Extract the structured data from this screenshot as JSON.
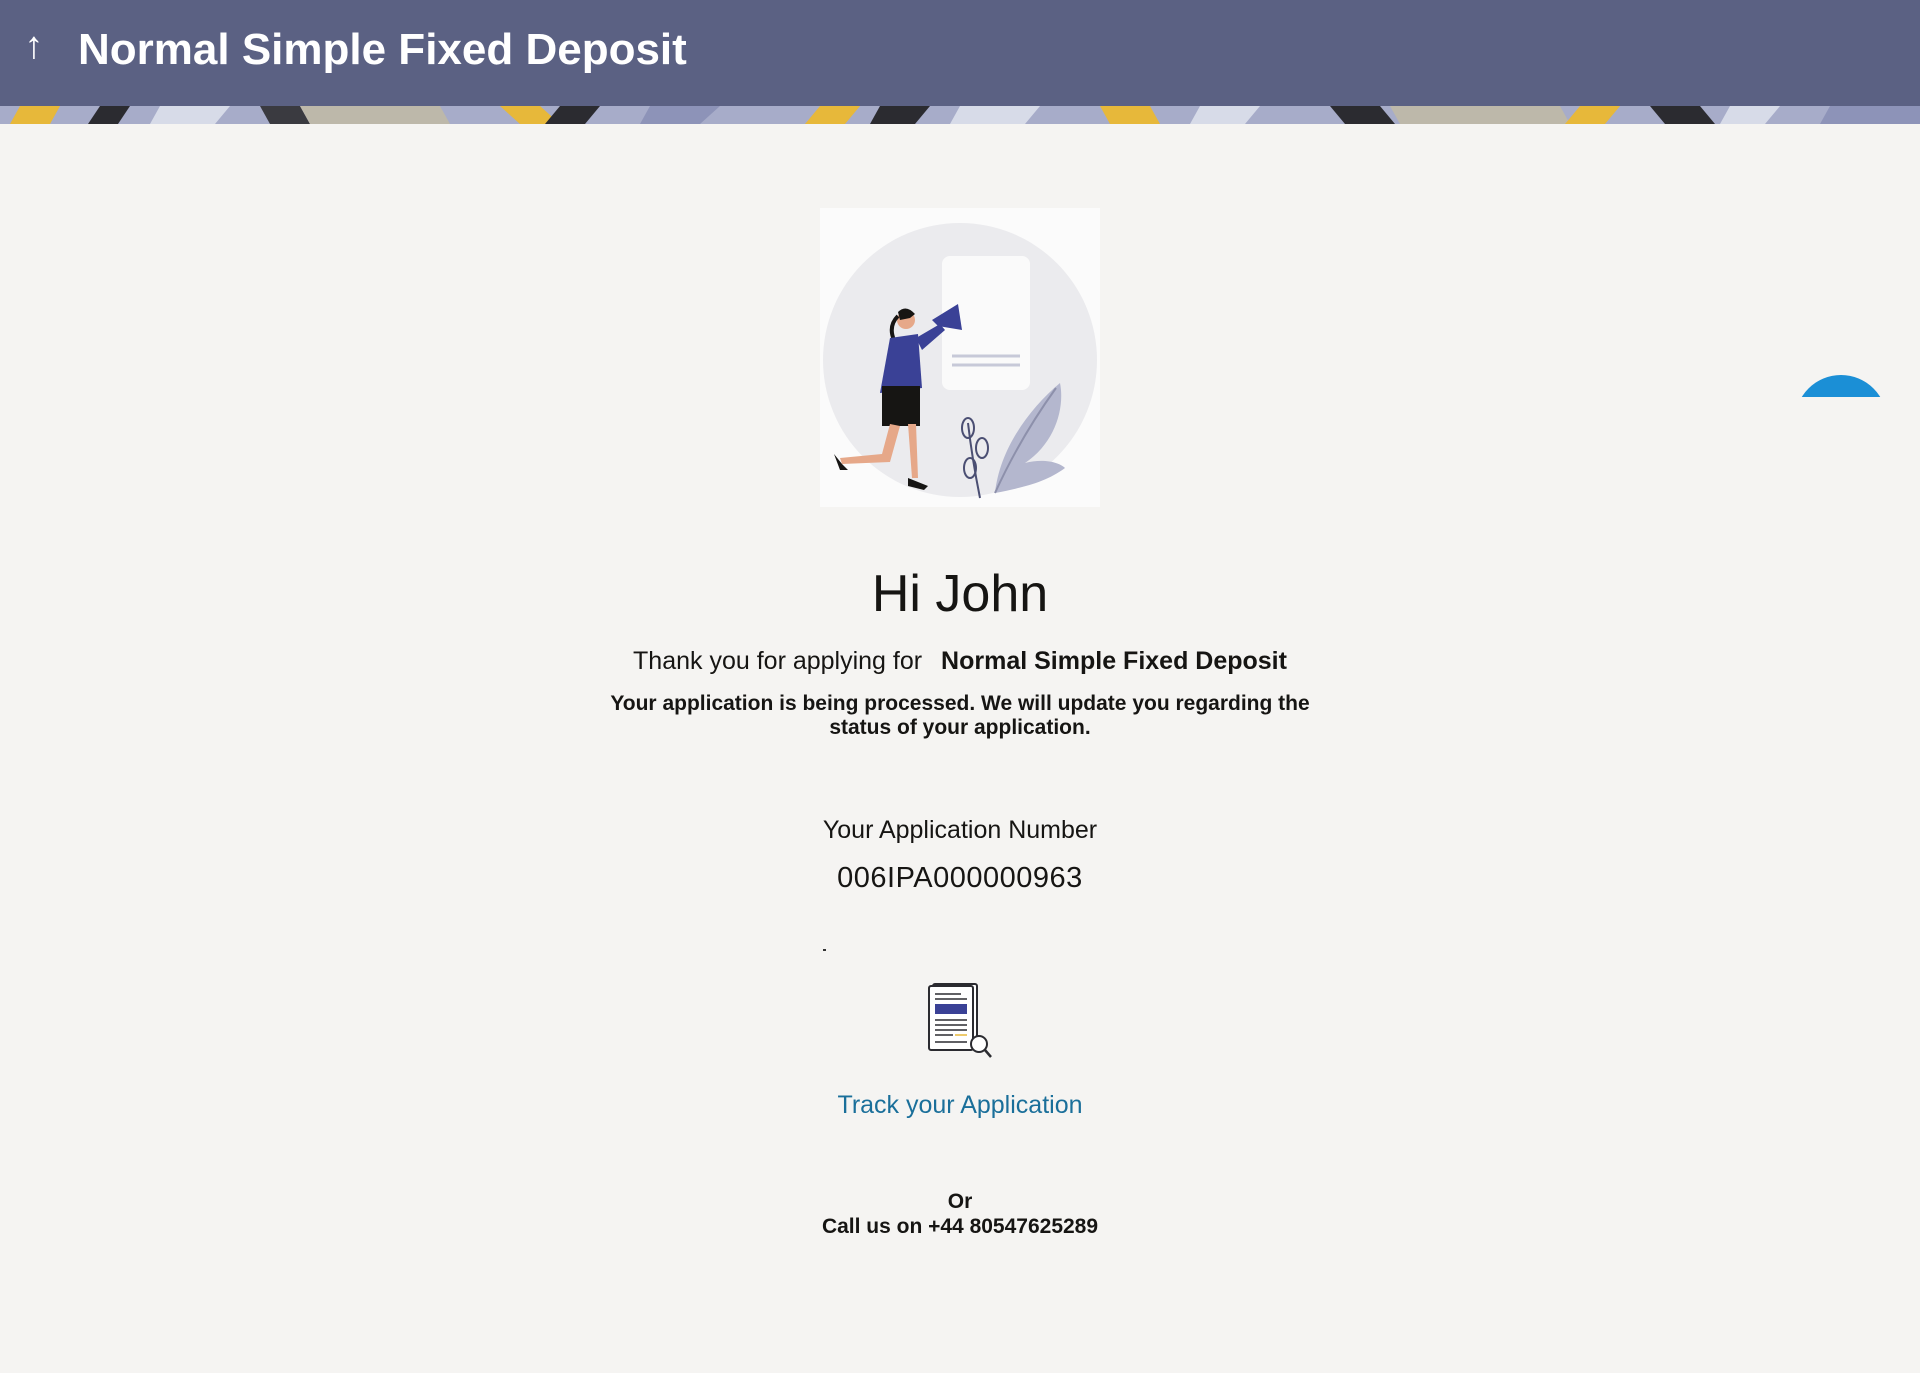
{
  "header": {
    "title": "Normal Simple Fixed Deposit",
    "back_icon": "up-arrow-icon",
    "background": "#5b6183"
  },
  "confirmation": {
    "greeting": "Hi John",
    "thanks_prefix": "Thank you for applying for",
    "product_name": "Normal Simple Fixed Deposit",
    "processing_message": "Your application is being processed. We will update you regarding the status of your application.",
    "application_number_label": "Your Application Number",
    "application_number": "006IPA000000963",
    "track_icon": "document-search-icon",
    "track_link": "Track your Application",
    "or_text": "Or",
    "call_text": "Call us on +44 80547625289"
  },
  "colors": {
    "link": "#1a6f9a",
    "fab": "#1b8fd6",
    "page_background": "#f5f4f2"
  }
}
